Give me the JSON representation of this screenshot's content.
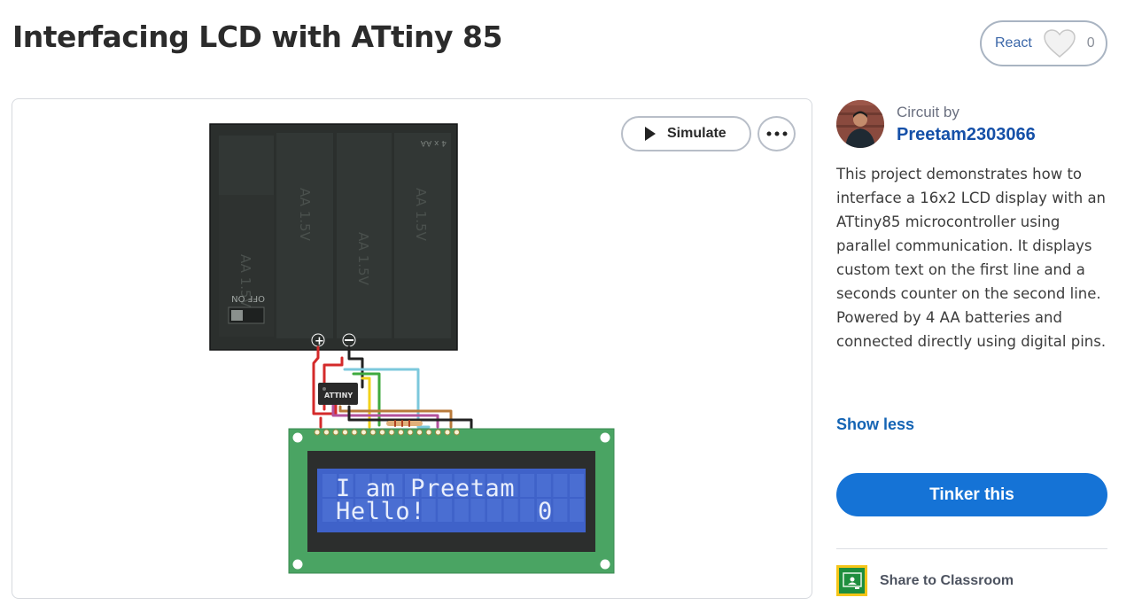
{
  "header": {
    "title": "Interfacing LCD with ATtiny 85",
    "react_label": "React",
    "react_count": "0"
  },
  "viewer": {
    "simulate_label": "Simulate",
    "lcd_line1": "I am Preetam",
    "lcd_line2": "Hello!",
    "lcd_counter": "0",
    "chip_label": "ATTINY",
    "battery_cells": [
      "AA 1.5V",
      "AA 1.5V",
      "AA 1.5V",
      "AA 1.5V"
    ],
    "battery_pack_label": "4 x AA",
    "switch_label": "OFF  ON"
  },
  "sidebar": {
    "circuit_by": "Circuit by",
    "author": "Preetam2303066",
    "description": "This project demonstrates how to interface a 16x2 LCD display with an ATtiny85 microcontroller using parallel communication. It displays custom text on the first line and a seconds counter on the second line. Powered by 4 AA batteries and connected directly using digital pins.",
    "show_less": "Show less",
    "tinker_label": "Tinker this",
    "share_label": "Share to Classroom"
  },
  "colors": {
    "primary": "#1573d6",
    "link": "#1464b4",
    "lcd_background": "#3f62c9",
    "lcd_text": "#e8eefc",
    "pcb_green": "#4aa463",
    "battery_body": "#2b2f2d"
  },
  "icons": {
    "heart": "heart-icon",
    "play": "play-icon",
    "more": "more-icon",
    "classroom": "classroom-icon"
  }
}
